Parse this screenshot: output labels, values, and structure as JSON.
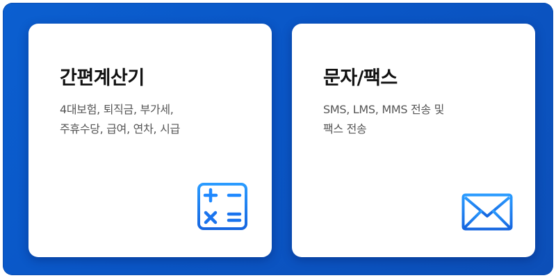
{
  "cards": [
    {
      "title": "간편계산기",
      "description_lines": [
        "4대보험, 퇴직금, 부가세,",
        "주휴수당, 급여, 연차, 시급"
      ],
      "icon": "calculator-icon"
    },
    {
      "title": "문자/팩스",
      "description_lines": [
        "SMS, LMS, MMS 전송 및",
        "팩스 전송"
      ],
      "icon": "envelope-icon"
    }
  ],
  "colors": {
    "background_blue": "#0b5fd0",
    "icon_blue": "#1e88ff",
    "icon_blue_dark": "#1666e0",
    "title_text": "#111111",
    "desc_text": "#555555"
  }
}
